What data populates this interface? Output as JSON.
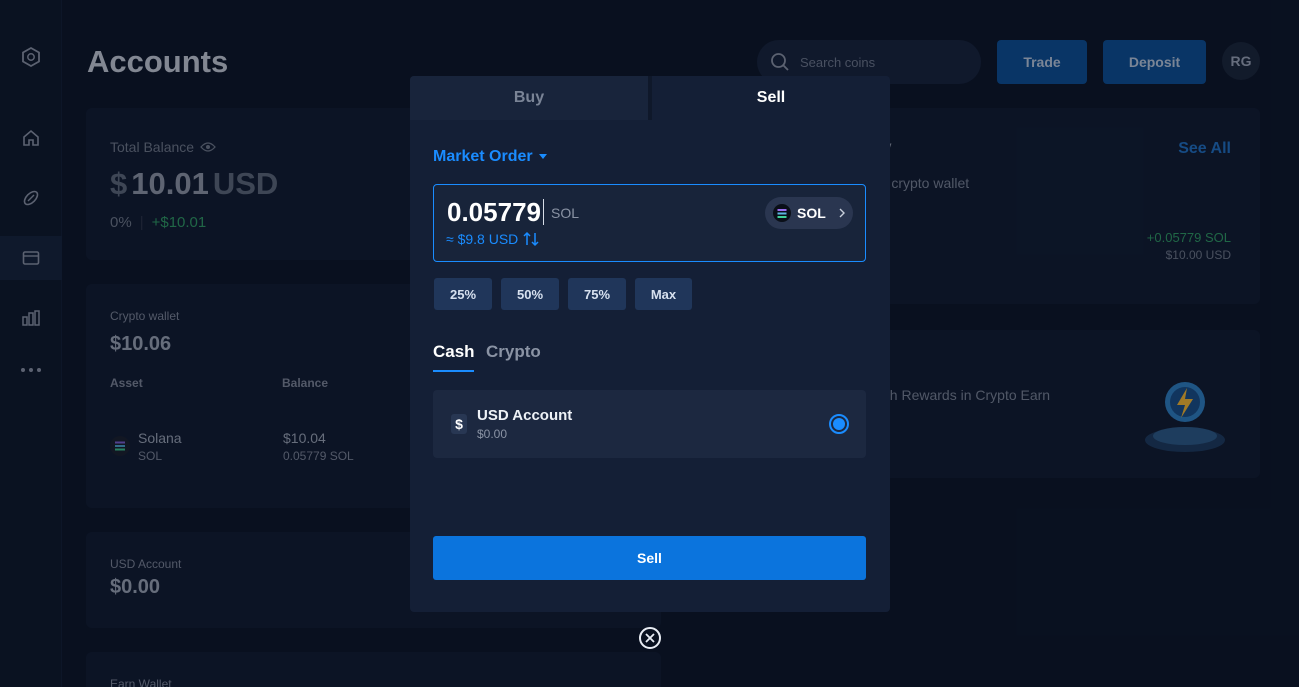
{
  "header": {
    "title": "Accounts",
    "search_placeholder": "Search coins",
    "trade_label": "Trade",
    "deposit_label": "Deposit",
    "avatar_initials": "RG"
  },
  "sidebar": {
    "items": [
      {
        "icon": "logo-icon"
      },
      {
        "icon": "home-icon"
      },
      {
        "icon": "rocket-icon"
      },
      {
        "icon": "wallet-icon",
        "active": true
      },
      {
        "icon": "chart-icon"
      },
      {
        "icon": "more-icon"
      }
    ]
  },
  "balance_card": {
    "label": "Total Balance",
    "currency_symbol": "$",
    "amount": "10.01",
    "currency": "USD",
    "change_pct": "0%",
    "change_amount": "+$10.01"
  },
  "crypto_wallet": {
    "label": "Crypto wallet",
    "amount": "$10.06",
    "col_asset": "Asset",
    "col_balance": "Balance",
    "rows": [
      {
        "name": "Solana",
        "ticker": "SOL",
        "usd": "$10.04",
        "amount": "0.05779 SOL"
      }
    ]
  },
  "usd_account_card": {
    "label": "USD Account",
    "amount": "$0.00"
  },
  "earn_wallet_card": {
    "label": "Earn Wallet"
  },
  "history_card": {
    "title_fragment": "y",
    "see_all": "See All",
    "subtitle_fragment": "ur crypto wallet",
    "amount": "+0.05779 SOL",
    "usd": "$10.00 USD"
  },
  "promo_card": {
    "text_fragment": "ash Rewards in Crypto Earn"
  },
  "modal": {
    "tabs": [
      "Buy",
      "Sell"
    ],
    "active_tab": "Sell",
    "order_type": "Market Order",
    "amount": "0.05779",
    "amount_unit": "SOL",
    "amount_usd": "≈ $9.8 USD",
    "coin": "SOL",
    "percent_buttons": [
      "25%",
      "50%",
      "75%",
      "Max"
    ],
    "payout_tabs": [
      "Cash",
      "Crypto"
    ],
    "active_payout": "Cash",
    "account": {
      "name": "USD Account",
      "balance": "$0.00",
      "selected": true
    },
    "submit_label": "Sell"
  },
  "colors": {
    "accent": "#1a8cff",
    "button": "#0b74dd",
    "positive": "#2f9a62",
    "background": "#0b1426"
  }
}
